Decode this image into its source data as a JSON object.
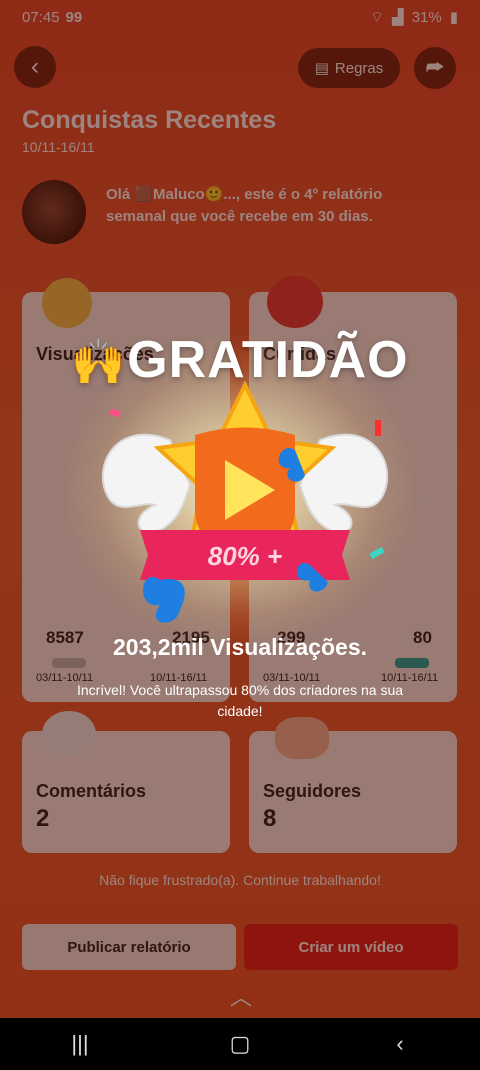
{
  "status_bar": {
    "time": "07:45",
    "carrier_badge": "99",
    "battery": "31%"
  },
  "header": {
    "rules_label": "Regras"
  },
  "report": {
    "title": "Conquistas Recentes",
    "date_range": "10/11-16/11",
    "greeting": "Olá 🟫Maluco🙂..., este é o 4º relatório semanal que você recebe em 30 dias."
  },
  "cards": {
    "views": {
      "label": "Visualizações",
      "prev_value": "8587",
      "curr_value": "2195",
      "prev_date": "03/11-10/11",
      "curr_date": "10/11-16/11"
    },
    "likes": {
      "label": "Curtidas",
      "prev_value": "299",
      "curr_value": "80",
      "prev_date": "03/11-10/11",
      "curr_date": "10/11-16/11"
    },
    "comments": {
      "label": "Comentários",
      "value": "2"
    },
    "followers": {
      "label": "Seguidores",
      "value": "8"
    }
  },
  "footer": {
    "encourage_text": "Não fique frustrado(a). Continue trabalhando!",
    "publish_label": "Publicar relatório",
    "create_label": "Criar um vídeo"
  },
  "popup": {
    "headline_emoji": "🙌",
    "headline": "GRATIDÃO",
    "badge_text": "80% +",
    "subtitle": "203,2mil Visualizações.",
    "description": "Incrível! Você ultrapassou 80% dos criadores na sua cidade!"
  },
  "colors": {
    "accent_red": "#e0201c",
    "dark_button": "#6c2414",
    "card_bg": "#f7ece6"
  },
  "icons": [
    "back-icon",
    "rules-icon",
    "share-icon",
    "wifi-icon",
    "signal-icon",
    "battery-icon",
    "recents-icon",
    "home-icon",
    "nav-back-icon",
    "chevron-up-icon"
  ]
}
